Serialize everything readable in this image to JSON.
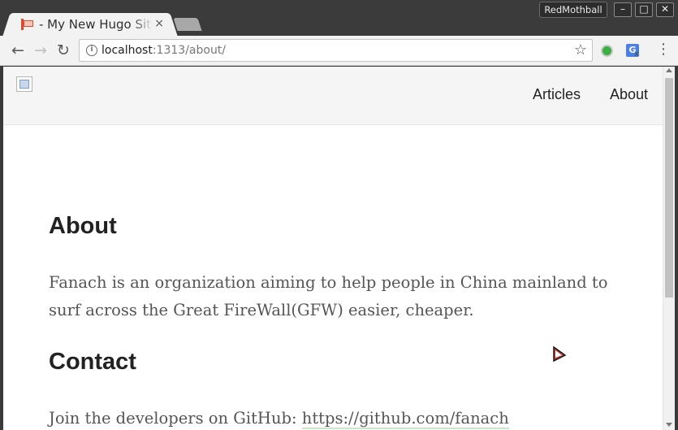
{
  "browser": {
    "tab": {
      "title": "- My New Hugo Site",
      "close": "×"
    },
    "profile": "RedMothball",
    "window_controls": {
      "minimize": "–",
      "maximize": "□",
      "close": "✕"
    },
    "nav": {
      "back": "←",
      "forward": "→",
      "reload": "↻"
    },
    "address": {
      "info": "i",
      "host": "localhost",
      "rest": ":1313/about/"
    },
    "icons": {
      "star": "☆",
      "menu": "⋮",
      "translate": "G",
      "translate_x": "x"
    }
  },
  "site": {
    "nav": {
      "articles": "Articles",
      "about": "About"
    }
  },
  "page": {
    "heading_about": "About",
    "about_text": "Fanach is an organization aiming to help people in China mainland to surf across the Great FireWall(GFW) easier, cheaper.",
    "heading_contact": "Contact",
    "contact_prefix": "Join the developers on GitHub: ",
    "contact_link": "https://github.com/fanach"
  }
}
